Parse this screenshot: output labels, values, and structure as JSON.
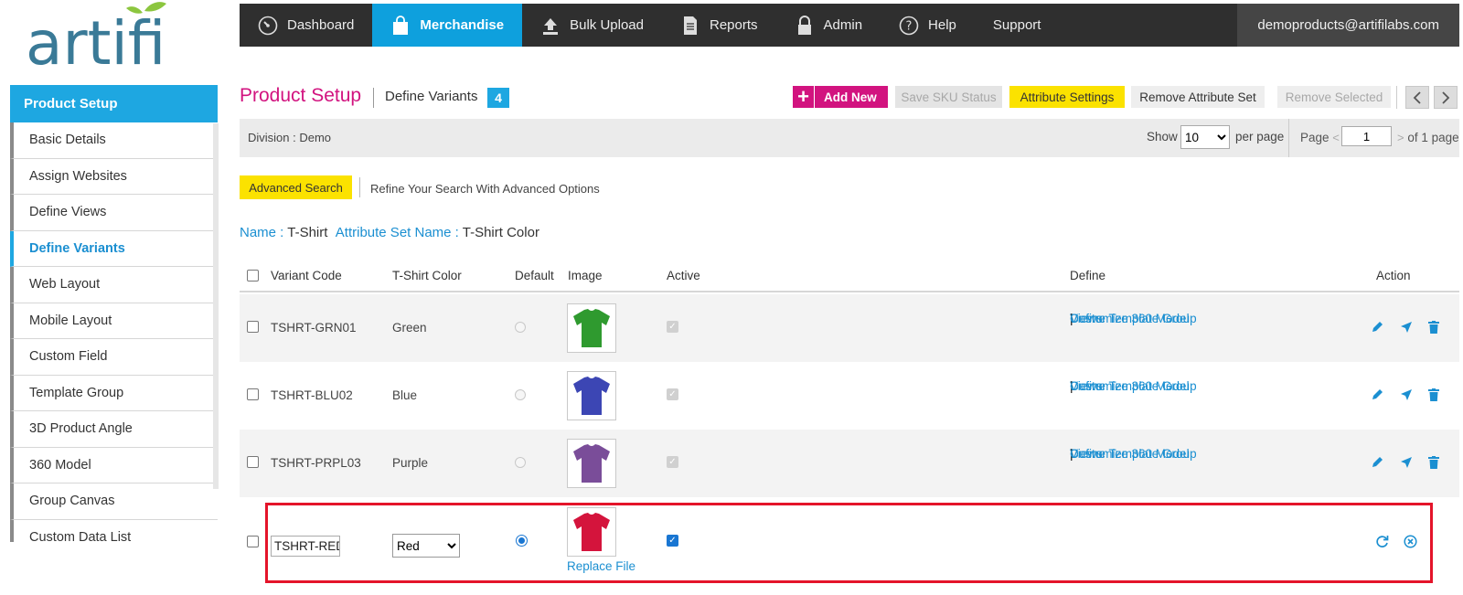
{
  "logo": {
    "text": "artifi"
  },
  "nav": {
    "items": [
      {
        "label": "Dashboard",
        "icon": "speedometer-icon"
      },
      {
        "label": "Merchandise",
        "icon": "shopping-bag-icon",
        "active": true
      },
      {
        "label": "Bulk Upload",
        "icon": "upload-icon"
      },
      {
        "label": "Reports",
        "icon": "document-icon"
      },
      {
        "label": "Admin",
        "icon": "lock-icon"
      },
      {
        "label": "Help",
        "icon": "help-circle-icon"
      },
      {
        "label": "Support",
        "icon": ""
      }
    ],
    "user": "demoproducts@artifilabs.com"
  },
  "sidebar": {
    "heading": "Product Setup",
    "items": [
      {
        "label": "Basic Details"
      },
      {
        "label": "Assign Websites"
      },
      {
        "label": "Define Views"
      },
      {
        "label": "Define Variants",
        "active": true
      },
      {
        "label": "Web Layout"
      },
      {
        "label": "Mobile Layout"
      },
      {
        "label": "Custom Field"
      },
      {
        "label": "Template Group"
      },
      {
        "label": "3D Product Angle"
      },
      {
        "label": "360 Model"
      },
      {
        "label": "Group Canvas"
      },
      {
        "label": "Custom Data List"
      }
    ]
  },
  "header": {
    "title": "Product Setup",
    "subtitle": "Define Variants",
    "count": "4",
    "buttons": {
      "add_new": "Add New",
      "save_sku": "Save SKU Status",
      "attribute_settings": "Attribute Settings",
      "remove_attribute_set": "Remove Attribute Set",
      "remove_selected": "Remove Selected"
    }
  },
  "division": {
    "label": "Division :  Demo",
    "show": "Show",
    "per_page_value": "10",
    "per_page_options": [
      "10"
    ],
    "per_page": "per page",
    "page": "Page",
    "page_prev": "<",
    "page_value": "1",
    "page_next": ">",
    "of_pages": "of 1 page"
  },
  "search": {
    "advanced": "Advanced Search",
    "refine": "Refine Your Search With Advanced Options"
  },
  "info": {
    "name_label": "Name : ",
    "name_value": "T-Shirt",
    "attr_label": "Attribute Set Name : ",
    "attr_value": "T-Shirt Color"
  },
  "table": {
    "columns": {
      "variant_code": "Variant Code",
      "color": "T-Shirt Color",
      "default": "Default",
      "image": "Image",
      "active": "Active",
      "define": "Define",
      "action": "Action"
    },
    "define_links": {
      "views": "Views",
      "template_group": "Define Template Group",
      "customize": "Customize 360 Model",
      "sep": "|"
    },
    "rows": [
      {
        "code": "TSHRT-GRN01",
        "color": "Green",
        "swatch": "#2f9a2f"
      },
      {
        "code": "TSHRT-BLU02",
        "color": "Blue",
        "swatch": "#3c46b4"
      },
      {
        "code": "TSHRT-PRPL03",
        "color": "Purple",
        "swatch": "#7a4d99"
      }
    ],
    "edit_row": {
      "code": "TSHRT-RED",
      "color": "Red",
      "color_options": [
        "Red"
      ],
      "swatch": "#d4143c",
      "replace_file": "Replace File"
    }
  },
  "colors": {
    "brand_pink": "#d2137f",
    "brand_blue": "#1ea7e1",
    "highlight_yellow": "#fbe200",
    "edit_outline": "#e4142a"
  }
}
